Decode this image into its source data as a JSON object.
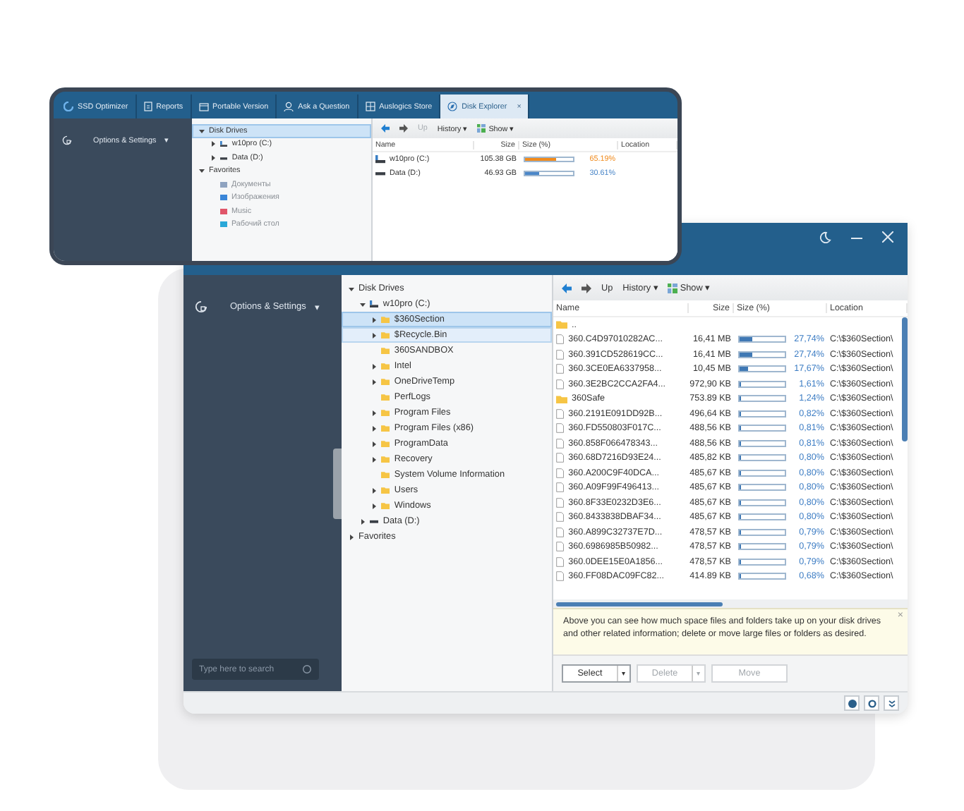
{
  "front_window": {
    "tabs": [
      {
        "label": "SSD Optimizer",
        "selected": false
      },
      {
        "label": "Reports",
        "selected": false
      },
      {
        "label": "Portable Version",
        "selected": false
      },
      {
        "label": "Ask a Question",
        "selected": false
      },
      {
        "label": "Auslogics Store",
        "selected": false
      },
      {
        "label": "Disk Explorer",
        "selected": true,
        "close": "×"
      }
    ],
    "sidebar": {
      "menu": "Options & Settings",
      "caret": "▾"
    },
    "tree": [
      {
        "label": "Disk Drives",
        "expanded": true,
        "selected": true,
        "children": [
          {
            "label": "w10pro (C:)",
            "kind": "system-drive",
            "expanded": false,
            "selected": false
          },
          {
            "label": "Data (D:)",
            "kind": "drive",
            "expanded": false,
            "selected": false
          }
        ]
      },
      {
        "label": "Favorites",
        "expanded": true,
        "selected": false,
        "children": [
          {
            "label": "Документы",
            "kind": "favorite",
            "color": "#8fa3c0",
            "selected": false
          },
          {
            "label": "Изображения",
            "kind": "favorite",
            "color": "#3a86d8",
            "selected": false
          },
          {
            "label": "Music",
            "kind": "favorite",
            "color": "#e0566a",
            "selected": false
          },
          {
            "label": "Рабочий стол",
            "kind": "favorite",
            "color": "#2aa8d8",
            "selected": false
          }
        ]
      }
    ],
    "toolbar": {
      "up": "Up",
      "up_disabled": true,
      "history": "History",
      "show": "Show",
      "caret": "▾"
    },
    "columns": [
      "Name",
      "Size",
      "Size (%)",
      "Location"
    ],
    "rows": [
      {
        "name": "w10pro (C:)",
        "kind": "system-drive",
        "size": "105.38 GB",
        "level": 0.6519,
        "percent": "65.19%",
        "color": "#f08a1c"
      },
      {
        "name": "Data (D:)",
        "kind": "drive",
        "size": "46.93 GB",
        "level": 0.3061,
        "percent": "30.61%",
        "color": "#4a86c8"
      }
    ]
  },
  "back_window": {
    "sidebar": {
      "menu": "Options & Settings",
      "caret": "▾",
      "search_placeholder": "Type here to search"
    },
    "tree": [
      {
        "label": "Disk Drives",
        "expanded": true,
        "selected": false,
        "children": [
          {
            "label": "w10pro (C:)",
            "kind": "system-drive",
            "expanded": true,
            "selected": false,
            "children": [
              {
                "label": "$360Section",
                "kind": "folder",
                "expanded": false,
                "selected": true
              },
              {
                "label": "$Recycle.Bin",
                "kind": "folder",
                "expanded": false,
                "selected": false,
                "hovered": true
              },
              {
                "label": "360SANDBOX",
                "kind": "folder",
                "selected": false
              },
              {
                "label": "Intel",
                "kind": "folder",
                "expanded": false,
                "selected": false
              },
              {
                "label": "OneDriveTemp",
                "kind": "folder",
                "expanded": false,
                "selected": false
              },
              {
                "label": "PerfLogs",
                "kind": "folder",
                "selected": false
              },
              {
                "label": "Program Files",
                "kind": "folder",
                "expanded": false,
                "selected": false
              },
              {
                "label": "Program Files (x86)",
                "kind": "folder",
                "expanded": false,
                "selected": false
              },
              {
                "label": "ProgramData",
                "kind": "folder",
                "expanded": false,
                "selected": false
              },
              {
                "label": "Recovery",
                "kind": "folder",
                "expanded": false,
                "selected": false
              },
              {
                "label": "System Volume Information",
                "kind": "folder",
                "selected": false
              },
              {
                "label": "Users",
                "kind": "folder",
                "expanded": false,
                "selected": false
              },
              {
                "label": "Windows",
                "kind": "folder",
                "expanded": false,
                "selected": false
              }
            ]
          },
          {
            "label": "Data (D:)",
            "kind": "drive",
            "expanded": false,
            "selected": false
          }
        ]
      },
      {
        "label": "Favorites",
        "expanded": false,
        "selected": false
      }
    ],
    "toolbar": {
      "up": "Up",
      "up_disabled": false,
      "history": "History",
      "show": "Show",
      "caret": "▾"
    },
    "columns": [
      "Name",
      "Size",
      "Size (%)",
      "Location"
    ],
    "rows": [
      {
        "name": "..",
        "kind": "parent"
      },
      {
        "name": "360.C4D97010282AC...",
        "kind": "file",
        "size": "16,41 MB",
        "level": 0.2774,
        "percent": "27,74%",
        "location": "C:\\$360Section\\"
      },
      {
        "name": "360.391CD528619CC...",
        "kind": "file",
        "size": "16,41 MB",
        "level": 0.2774,
        "percent": "27,74%",
        "location": "C:\\$360Section\\"
      },
      {
        "name": "360.3CE0EA6337958...",
        "kind": "file",
        "size": "10,45 MB",
        "level": 0.1767,
        "percent": "17,67%",
        "location": "C:\\$360Section\\"
      },
      {
        "name": "360.3E2BC2CCA2FA4...",
        "kind": "file",
        "size": "972,90 KB",
        "level": 0.0161,
        "percent": "1,61%",
        "location": "C:\\$360Section\\"
      },
      {
        "name": "360Safe",
        "kind": "folder",
        "size": "753.89 KB",
        "level": 0.0124,
        "percent": "1,24%",
        "location": "C:\\$360Section\\"
      },
      {
        "name": "360.2191E091DD92B...",
        "kind": "file",
        "size": "496,64 KB",
        "level": 0.0082,
        "percent": "0,82%",
        "location": "C:\\$360Section\\"
      },
      {
        "name": "360.FD550803F017C...",
        "kind": "file",
        "size": "488,56 KB",
        "level": 0.0081,
        "percent": "0,81%",
        "location": "C:\\$360Section\\"
      },
      {
        "name": "360.858F066478343...",
        "kind": "file",
        "size": "488,56 KB",
        "level": 0.0081,
        "percent": "0,81%",
        "location": "C:\\$360Section\\"
      },
      {
        "name": "360.68D7216D93E24...",
        "kind": "file",
        "size": "485,82 KB",
        "level": 0.008,
        "percent": "0,80%",
        "location": "C:\\$360Section\\"
      },
      {
        "name": "360.A200C9F40DCA...",
        "kind": "file",
        "size": "485,67 KB",
        "level": 0.008,
        "percent": "0,80%",
        "location": "C:\\$360Section\\"
      },
      {
        "name": "360.A09F99F496413...",
        "kind": "file",
        "size": "485,67 KB",
        "level": 0.008,
        "percent": "0,80%",
        "location": "C:\\$360Section\\"
      },
      {
        "name": "360.8F33E0232D3E6...",
        "kind": "file",
        "size": "485,67 KB",
        "level": 0.008,
        "percent": "0,80%",
        "location": "C:\\$360Section\\"
      },
      {
        "name": "360.8433838DBAF34...",
        "kind": "file",
        "size": "485,67 KB",
        "level": 0.008,
        "percent": "0,80%",
        "location": "C:\\$360Section\\"
      },
      {
        "name": "360.A899C32737E7D...",
        "kind": "file",
        "size": "478,57 KB",
        "level": 0.0079,
        "percent": "0,79%",
        "location": "C:\\$360Section\\"
      },
      {
        "name": "360.6986985B50982...",
        "kind": "file",
        "size": "478,57 KB",
        "level": 0.0079,
        "percent": "0,79%",
        "location": "C:\\$360Section\\"
      },
      {
        "name": "360.0DEE15E0A1856...",
        "kind": "file",
        "size": "478,57 KB",
        "level": 0.0079,
        "percent": "0,79%",
        "location": "C:\\$360Section\\"
      },
      {
        "name": "360.FF08DAC09FC82...",
        "kind": "file",
        "size": "414.89 KB",
        "level": 0.0068,
        "percent": "0,68%",
        "location": "C:\\$360Section\\"
      }
    ],
    "info": "Above you can see how much space files and folders take up on your disk drives and other related information; delete or move large files or folders as desired.",
    "info_close": "×",
    "buttons": [
      {
        "label": "Select",
        "disabled": false,
        "menu": true
      },
      {
        "label": "Delete",
        "disabled": true,
        "menu": true
      },
      {
        "label": "Move",
        "disabled": true,
        "menu": false
      }
    ],
    "menu_caret": "▾"
  }
}
